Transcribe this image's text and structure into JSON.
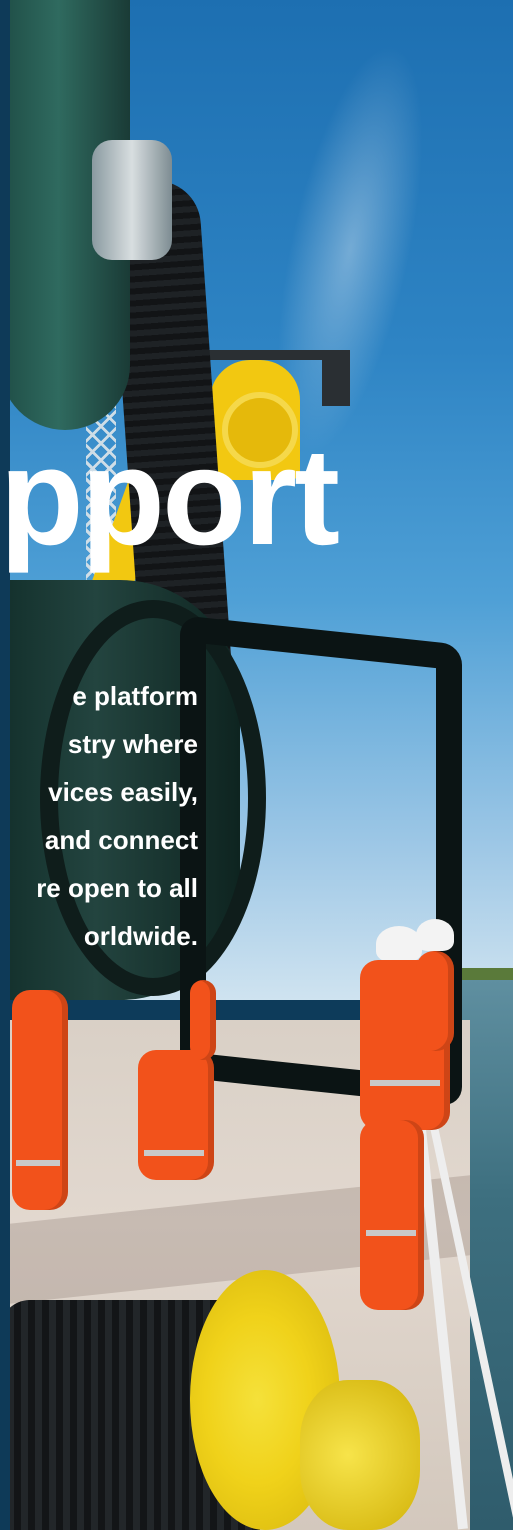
{
  "hero": {
    "heading_fragment": "pport",
    "description_lines": [
      "e platform",
      "stry where",
      "vices easily,",
      "and connect",
      "re open to all",
      "orldwide."
    ]
  },
  "colors": {
    "text": "#ffffff",
    "left_strip": "#0e3a58",
    "sky": "#2e84c4",
    "safety_orange": "#f2521b",
    "machinery_yellow": "#f2c811"
  },
  "scene": {
    "image_subject": "ship-deck-workers-pipes"
  }
}
